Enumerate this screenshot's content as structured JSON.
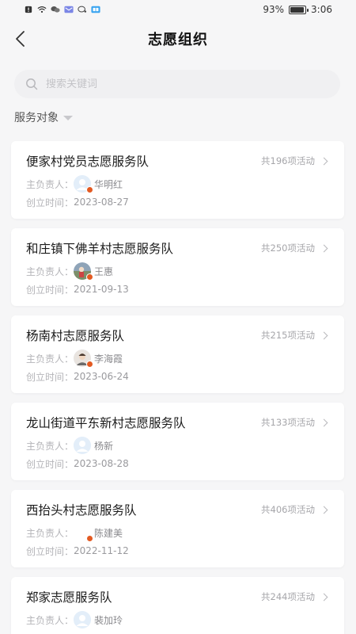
{
  "status_bar": {
    "battery": "93%",
    "time": "3:06",
    "battery_level": 0.93
  },
  "header": {
    "title": "志愿组织"
  },
  "search": {
    "placeholder": "搜索关键词",
    "value": ""
  },
  "filter": {
    "label": "服务对象"
  },
  "labels": {
    "owner": "主负责人：",
    "created": "创立时间："
  },
  "organizations": [
    {
      "name": "便家村党员志愿服务队",
      "count": "共196项活动",
      "owner": "华明红",
      "date": "2023-08-27",
      "avatar": "default-avatar"
    },
    {
      "name": "和庄镇下佛羊村志愿服务队",
      "count": "共250项活动",
      "owner": "王惠",
      "date": "2021-09-13",
      "avatar": "photo-avatar"
    },
    {
      "name": "杨南村志愿服务队",
      "count": "共215项活动",
      "owner": "李海霞",
      "date": "2023-06-24",
      "avatar": "photo-avatar"
    },
    {
      "name": "龙山街道平东新村志愿服务队",
      "count": "共133项活动",
      "owner": "杨新",
      "date": "2023-08-28",
      "avatar": "default-avatar"
    },
    {
      "name": "西抬头村志愿服务队",
      "count": "共406项活动",
      "owner": "陈建美",
      "date": "2022-11-12",
      "avatar": "blank-avatar"
    },
    {
      "name": "郑家志愿服务队",
      "count": "共244项活动",
      "owner": "裴加玲",
      "date": "",
      "avatar": "default-avatar"
    }
  ],
  "colors": {
    "background": "#f6f6f7",
    "card": "#ffffff",
    "badge": "#e35a22",
    "muted_text": "#b0b0b4"
  }
}
